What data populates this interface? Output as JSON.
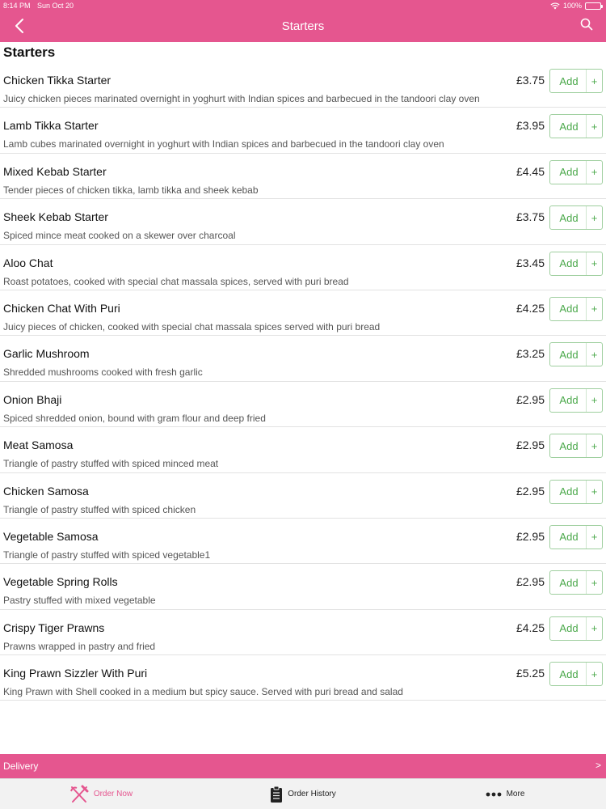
{
  "status_bar": {
    "time": "8:14 PM",
    "date": "Sun Oct 20",
    "battery": "100%"
  },
  "nav": {
    "title": "Starters",
    "back_icon": "chevron-left-icon",
    "search_icon": "search-icon"
  },
  "section": {
    "title": "Starters"
  },
  "menu": {
    "add_label": "Add",
    "plus_label": "+",
    "items": [
      {
        "name": "Chicken Tikka Starter",
        "price": "£3.75",
        "description": "Juicy chicken pieces marinated overnight in yoghurt with Indian spices and barbecued in the tandoori clay oven"
      },
      {
        "name": "Lamb Tikka Starter",
        "price": "£3.95",
        "description": "Lamb cubes marinated overnight in yoghurt with Indian spices and barbecued in the tandoori clay oven"
      },
      {
        "name": "Mixed Kebab Starter",
        "price": "£4.45",
        "description": "Tender pieces of chicken tikka, lamb tikka and sheek kebab"
      },
      {
        "name": "Sheek Kebab Starter",
        "price": "£3.75",
        "description": "Spiced mince meat cooked on a skewer over charcoal"
      },
      {
        "name": "Aloo Chat",
        "price": "£3.45",
        "description": "Roast potatoes, cooked with special chat massala spices, served with puri bread"
      },
      {
        "name": "Chicken Chat With Puri",
        "price": "£4.25",
        "description": "Juicy pieces of chicken, cooked with special chat massala spices served with puri bread"
      },
      {
        "name": "Garlic Mushroom",
        "price": "£3.25",
        "description": "Shredded mushrooms cooked with fresh garlic"
      },
      {
        "name": "Onion Bhaji",
        "price": "£2.95",
        "description": "Spiced shredded onion, bound with gram flour and deep fried"
      },
      {
        "name": "Meat Samosa",
        "price": "£2.95",
        "description": "Triangle of pastry stuffed with spiced minced meat"
      },
      {
        "name": "Chicken Samosa",
        "price": "£2.95",
        "description": "Triangle of pastry stuffed with spiced chicken"
      },
      {
        "name": "Vegetable Samosa",
        "price": "£2.95",
        "description": "Triangle of pastry stuffed with spiced vegetable1"
      },
      {
        "name": "Vegetable Spring Rolls",
        "price": "£2.95",
        "description": "Pastry stuffed with mixed vegetable"
      },
      {
        "name": "Crispy Tiger Prawns",
        "price": "£4.25",
        "description": "Prawns wrapped in pastry and fried"
      },
      {
        "name": "King Prawn Sizzler With Puri",
        "price": "£5.25",
        "description": "King Prawn with Shell cooked in a medium but spicy sauce. Served with puri bread and salad"
      }
    ]
  },
  "delivery": {
    "label": "Delivery",
    "arrow": ">"
  },
  "tabs": [
    {
      "label": "Order Now",
      "icon": "fork-knife-icon",
      "active": true
    },
    {
      "label": "Order History",
      "icon": "clipboard-icon",
      "active": false
    },
    {
      "label": "More",
      "icon": "more-dots-icon",
      "active": false
    }
  ],
  "colors": {
    "brand_pink": "#e5568f",
    "add_green": "#4aa84a",
    "tab_bar_bg": "#f2f2f2"
  }
}
